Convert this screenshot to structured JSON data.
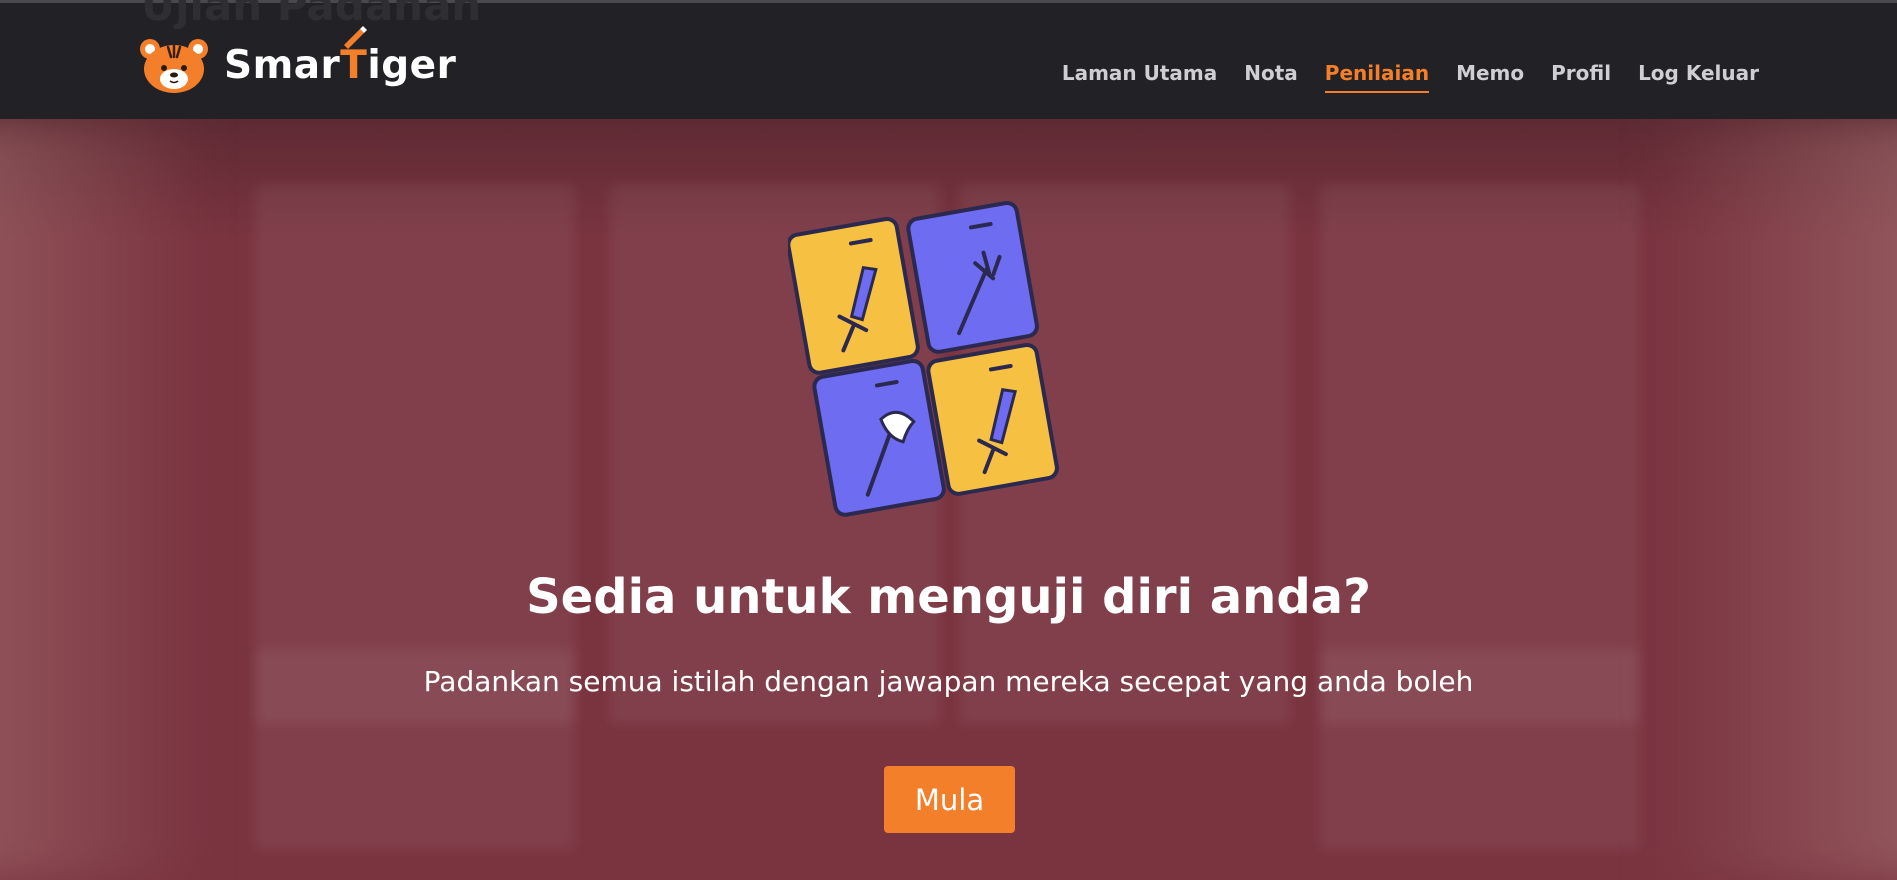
{
  "page": {
    "background_title": "Ujian Padanan"
  },
  "brand": {
    "name_part1": "Smar",
    "name_highlight": "T",
    "name_part2": "iger"
  },
  "nav": {
    "links": [
      "Laman Utama",
      "Nota",
      "Penilaian",
      "Memo",
      "Profil",
      "Log Keluar"
    ],
    "active": "Penilaian"
  },
  "hero": {
    "title": "Sedia untuk menguji diri anda?",
    "subtitle": "Padankan semua istilah dengan jawapan mereka secepat yang anda boleh",
    "start_label": "Mula"
  },
  "colors": {
    "accent": "#f47f2b",
    "navbar": "#222226",
    "overlay": "#7a3440",
    "card_yellow": "#f6c042",
    "card_purple": "#6e6cf0"
  },
  "icons": {
    "logo": "tiger-face-icon",
    "cards": [
      "sword-card-icon",
      "trident-card-icon",
      "axe-card-icon",
      "sword-card-icon"
    ]
  }
}
